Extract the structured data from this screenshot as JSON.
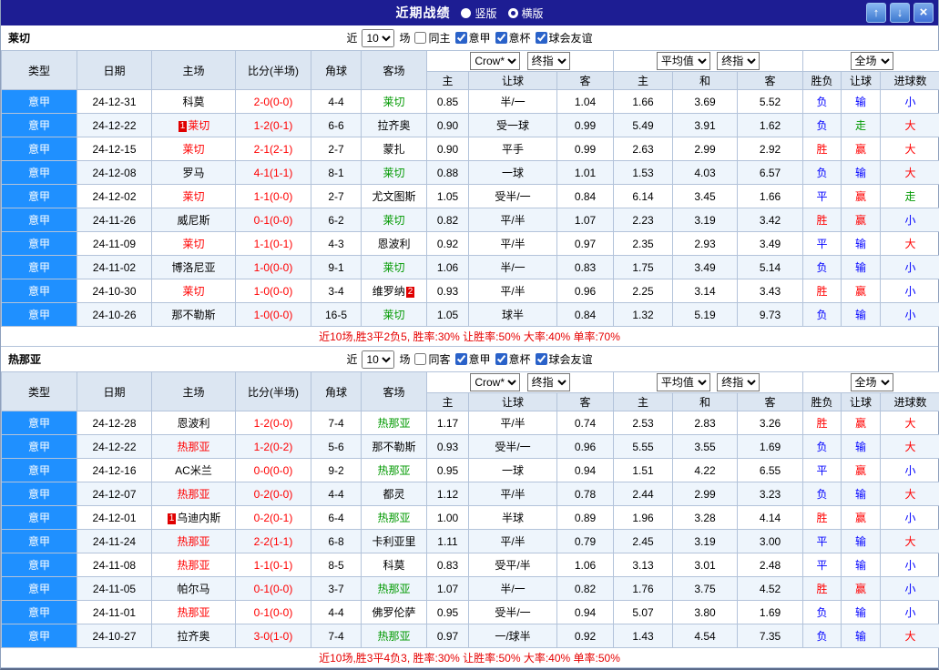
{
  "titlebar": {
    "title": "近期战绩",
    "radios": [
      {
        "label": "竖版",
        "checked": false
      },
      {
        "label": "横版",
        "checked": true
      }
    ],
    "buttons": {
      "up": "↑",
      "down": "↓",
      "close": "×"
    }
  },
  "colors": {
    "title_bg": "#1d1d93",
    "league_cell": "#1f90ff",
    "win": "#ff0000",
    "lose": "#0000ff",
    "push": "#008000"
  },
  "table_header": {
    "main_cols": [
      "类型",
      "日期",
      "主场",
      "比分(半场)",
      "角球",
      "客场"
    ],
    "group1": {
      "select1": "Crow*",
      "select2": "终指",
      "subs": [
        "主",
        "让球",
        "客"
      ]
    },
    "group2": {
      "select1": "平均值",
      "select2": "终指",
      "subs": [
        "主",
        "和",
        "客"
      ]
    },
    "group3": {
      "select": "全场",
      "subs": [
        "胜负",
        "让球",
        "进球数"
      ]
    }
  },
  "sections": [
    {
      "team": "莱切",
      "filter": {
        "prefix": "近",
        "count": "10",
        "suffix": "场",
        "same": {
          "label": "同主",
          "checked": false
        },
        "leagues": [
          {
            "label": "意甲",
            "checked": true
          },
          {
            "label": "意杯",
            "checked": true
          },
          {
            "label": "球会友谊",
            "checked": true
          }
        ]
      },
      "rows": [
        {
          "league": "意甲",
          "date": "24-12-31",
          "home": {
            "text": "科莫",
            "color": "black"
          },
          "score": "2-0(0-0)",
          "corner": "4-4",
          "away": {
            "text": "莱切",
            "color": "green"
          },
          "odds": [
            "0.85",
            "半/一",
            "1.04",
            "1.66",
            "3.69",
            "5.52"
          ],
          "results": [
            [
              "负",
              "blue"
            ],
            [
              "输",
              "blue"
            ],
            [
              "小",
              "blue"
            ]
          ]
        },
        {
          "league": "意甲",
          "date": "24-12-22",
          "home": {
            "text": "莱切",
            "color": "red",
            "badge_pre": "1"
          },
          "score": "1-2(0-1)",
          "corner": "6-6",
          "away": {
            "text": "拉齐奥",
            "color": "black"
          },
          "odds": [
            "0.90",
            "受一球",
            "0.99",
            "5.49",
            "3.91",
            "1.62"
          ],
          "results": [
            [
              "负",
              "blue"
            ],
            [
              "走",
              "green"
            ],
            [
              "大",
              "red"
            ]
          ]
        },
        {
          "league": "意甲",
          "date": "24-12-15",
          "home": {
            "text": "莱切",
            "color": "red"
          },
          "score": "2-1(2-1)",
          "corner": "2-7",
          "away": {
            "text": "蒙扎",
            "color": "black"
          },
          "odds": [
            "0.90",
            "平手",
            "0.99",
            "2.63",
            "2.99",
            "2.92"
          ],
          "results": [
            [
              "胜",
              "red"
            ],
            [
              "赢",
              "red"
            ],
            [
              "大",
              "red"
            ]
          ]
        },
        {
          "league": "意甲",
          "date": "24-12-08",
          "home": {
            "text": "罗马",
            "color": "black"
          },
          "score": "4-1(1-1)",
          "corner": "8-1",
          "away": {
            "text": "莱切",
            "color": "green"
          },
          "odds": [
            "0.88",
            "一球",
            "1.01",
            "1.53",
            "4.03",
            "6.57"
          ],
          "results": [
            [
              "负",
              "blue"
            ],
            [
              "输",
              "blue"
            ],
            [
              "大",
              "red"
            ]
          ]
        },
        {
          "league": "意甲",
          "date": "24-12-02",
          "home": {
            "text": "莱切",
            "color": "red"
          },
          "score": "1-1(0-0)",
          "corner": "2-7",
          "away": {
            "text": "尤文图斯",
            "color": "black"
          },
          "odds": [
            "1.05",
            "受半/一",
            "0.84",
            "6.14",
            "3.45",
            "1.66"
          ],
          "results": [
            [
              "平",
              "blue"
            ],
            [
              "赢",
              "red"
            ],
            [
              "走",
              "green"
            ]
          ]
        },
        {
          "league": "意甲",
          "date": "24-11-26",
          "home": {
            "text": "威尼斯",
            "color": "black"
          },
          "score": "0-1(0-0)",
          "corner": "6-2",
          "away": {
            "text": "莱切",
            "color": "green"
          },
          "odds": [
            "0.82",
            "平/半",
            "1.07",
            "2.23",
            "3.19",
            "3.42"
          ],
          "results": [
            [
              "胜",
              "red"
            ],
            [
              "赢",
              "red"
            ],
            [
              "小",
              "blue"
            ]
          ]
        },
        {
          "league": "意甲",
          "date": "24-11-09",
          "home": {
            "text": "莱切",
            "color": "red"
          },
          "score": "1-1(0-1)",
          "corner": "4-3",
          "away": {
            "text": "恩波利",
            "color": "black"
          },
          "odds": [
            "0.92",
            "平/半",
            "0.97",
            "2.35",
            "2.93",
            "3.49"
          ],
          "results": [
            [
              "平",
              "blue"
            ],
            [
              "输",
              "blue"
            ],
            [
              "大",
              "red"
            ]
          ]
        },
        {
          "league": "意甲",
          "date": "24-11-02",
          "home": {
            "text": "博洛尼亚",
            "color": "black"
          },
          "score": "1-0(0-0)",
          "corner": "9-1",
          "away": {
            "text": "莱切",
            "color": "green"
          },
          "odds": [
            "1.06",
            "半/一",
            "0.83",
            "1.75",
            "3.49",
            "5.14"
          ],
          "results": [
            [
              "负",
              "blue"
            ],
            [
              "输",
              "blue"
            ],
            [
              "小",
              "blue"
            ]
          ]
        },
        {
          "league": "意甲",
          "date": "24-10-30",
          "home": {
            "text": "莱切",
            "color": "red"
          },
          "score": "1-0(0-0)",
          "corner": "3-4",
          "away": {
            "text": "维罗纳",
            "color": "black",
            "badge_post": "2"
          },
          "odds": [
            "0.93",
            "平/半",
            "0.96",
            "2.25",
            "3.14",
            "3.43"
          ],
          "results": [
            [
              "胜",
              "red"
            ],
            [
              "赢",
              "red"
            ],
            [
              "小",
              "blue"
            ]
          ]
        },
        {
          "league": "意甲",
          "date": "24-10-26",
          "home": {
            "text": "那不勒斯",
            "color": "black"
          },
          "score": "1-0(0-0)",
          "corner": "16-5",
          "away": {
            "text": "莱切",
            "color": "green"
          },
          "odds": [
            "1.05",
            "球半",
            "0.84",
            "1.32",
            "5.19",
            "9.73"
          ],
          "results": [
            [
              "负",
              "blue"
            ],
            [
              "输",
              "blue"
            ],
            [
              "小",
              "blue"
            ]
          ]
        }
      ],
      "summary": "近10场,胜3平2负5, 胜率:30% 让胜率:50% 大率:40% 单率:70%"
    },
    {
      "team": "热那亚",
      "filter": {
        "prefix": "近",
        "count": "10",
        "suffix": "场",
        "same": {
          "label": "同客",
          "checked": false
        },
        "leagues": [
          {
            "label": "意甲",
            "checked": true
          },
          {
            "label": "意杯",
            "checked": true
          },
          {
            "label": "球会友谊",
            "checked": true
          }
        ]
      },
      "rows": [
        {
          "league": "意甲",
          "date": "24-12-28",
          "home": {
            "text": "恩波利",
            "color": "black"
          },
          "score": "1-2(0-0)",
          "corner": "7-4",
          "away": {
            "text": "热那亚",
            "color": "green"
          },
          "odds": [
            "1.17",
            "平/半",
            "0.74",
            "2.53",
            "2.83",
            "3.26"
          ],
          "results": [
            [
              "胜",
              "red"
            ],
            [
              "赢",
              "red"
            ],
            [
              "大",
              "red"
            ]
          ]
        },
        {
          "league": "意甲",
          "date": "24-12-22",
          "home": {
            "text": "热那亚",
            "color": "red"
          },
          "score": "1-2(0-2)",
          "corner": "5-6",
          "away": {
            "text": "那不勒斯",
            "color": "black"
          },
          "odds": [
            "0.93",
            "受半/一",
            "0.96",
            "5.55",
            "3.55",
            "1.69"
          ],
          "results": [
            [
              "负",
              "blue"
            ],
            [
              "输",
              "blue"
            ],
            [
              "大",
              "red"
            ]
          ]
        },
        {
          "league": "意甲",
          "date": "24-12-16",
          "home": {
            "text": "AC米兰",
            "color": "black"
          },
          "score": "0-0(0-0)",
          "corner": "9-2",
          "away": {
            "text": "热那亚",
            "color": "green"
          },
          "odds": [
            "0.95",
            "一球",
            "0.94",
            "1.51",
            "4.22",
            "6.55"
          ],
          "results": [
            [
              "平",
              "blue"
            ],
            [
              "赢",
              "red"
            ],
            [
              "小",
              "blue"
            ]
          ]
        },
        {
          "league": "意甲",
          "date": "24-12-07",
          "home": {
            "text": "热那亚",
            "color": "red"
          },
          "score": "0-2(0-0)",
          "corner": "4-4",
          "away": {
            "text": "都灵",
            "color": "black"
          },
          "odds": [
            "1.12",
            "平/半",
            "0.78",
            "2.44",
            "2.99",
            "3.23"
          ],
          "results": [
            [
              "负",
              "blue"
            ],
            [
              "输",
              "blue"
            ],
            [
              "大",
              "red"
            ]
          ]
        },
        {
          "league": "意甲",
          "date": "24-12-01",
          "home": {
            "text": "乌迪内斯",
            "color": "black",
            "badge_pre": "1"
          },
          "score": "0-2(0-1)",
          "corner": "6-4",
          "away": {
            "text": "热那亚",
            "color": "green"
          },
          "odds": [
            "1.00",
            "半球",
            "0.89",
            "1.96",
            "3.28",
            "4.14"
          ],
          "results": [
            [
              "胜",
              "red"
            ],
            [
              "赢",
              "red"
            ],
            [
              "小",
              "blue"
            ]
          ]
        },
        {
          "league": "意甲",
          "date": "24-11-24",
          "home": {
            "text": "热那亚",
            "color": "red"
          },
          "score": "2-2(1-1)",
          "corner": "6-8",
          "away": {
            "text": "卡利亚里",
            "color": "black"
          },
          "odds": [
            "1.11",
            "平/半",
            "0.79",
            "2.45",
            "3.19",
            "3.00"
          ],
          "results": [
            [
              "平",
              "blue"
            ],
            [
              "输",
              "blue"
            ],
            [
              "大",
              "red"
            ]
          ]
        },
        {
          "league": "意甲",
          "date": "24-11-08",
          "home": {
            "text": "热那亚",
            "color": "red"
          },
          "score": "1-1(0-1)",
          "corner": "8-5",
          "away": {
            "text": "科莫",
            "color": "black"
          },
          "odds": [
            "0.83",
            "受平/半",
            "1.06",
            "3.13",
            "3.01",
            "2.48"
          ],
          "results": [
            [
              "平",
              "blue"
            ],
            [
              "输",
              "blue"
            ],
            [
              "小",
              "blue"
            ]
          ]
        },
        {
          "league": "意甲",
          "date": "24-11-05",
          "home": {
            "text": "帕尔马",
            "color": "black"
          },
          "score": "0-1(0-0)",
          "corner": "3-7",
          "away": {
            "text": "热那亚",
            "color": "green"
          },
          "odds": [
            "1.07",
            "半/一",
            "0.82",
            "1.76",
            "3.75",
            "4.52"
          ],
          "results": [
            [
              "胜",
              "red"
            ],
            [
              "赢",
              "red"
            ],
            [
              "小",
              "blue"
            ]
          ]
        },
        {
          "league": "意甲",
          "date": "24-11-01",
          "home": {
            "text": "热那亚",
            "color": "red"
          },
          "score": "0-1(0-0)",
          "corner": "4-4",
          "away": {
            "text": "佛罗伦萨",
            "color": "black"
          },
          "odds": [
            "0.95",
            "受半/一",
            "0.94",
            "5.07",
            "3.80",
            "1.69"
          ],
          "results": [
            [
              "负",
              "blue"
            ],
            [
              "输",
              "blue"
            ],
            [
              "小",
              "blue"
            ]
          ]
        },
        {
          "league": "意甲",
          "date": "24-10-27",
          "home": {
            "text": "拉齐奥",
            "color": "black"
          },
          "score": "3-0(1-0)",
          "corner": "7-4",
          "away": {
            "text": "热那亚",
            "color": "green"
          },
          "odds": [
            "0.97",
            "一/球半",
            "0.92",
            "1.43",
            "4.54",
            "7.35"
          ],
          "results": [
            [
              "负",
              "blue"
            ],
            [
              "输",
              "blue"
            ],
            [
              "大",
              "red"
            ]
          ]
        }
      ],
      "summary": "近10场,胜3平4负3, 胜率:30% 让胜率:50% 大率:40% 单率:50%"
    }
  ]
}
